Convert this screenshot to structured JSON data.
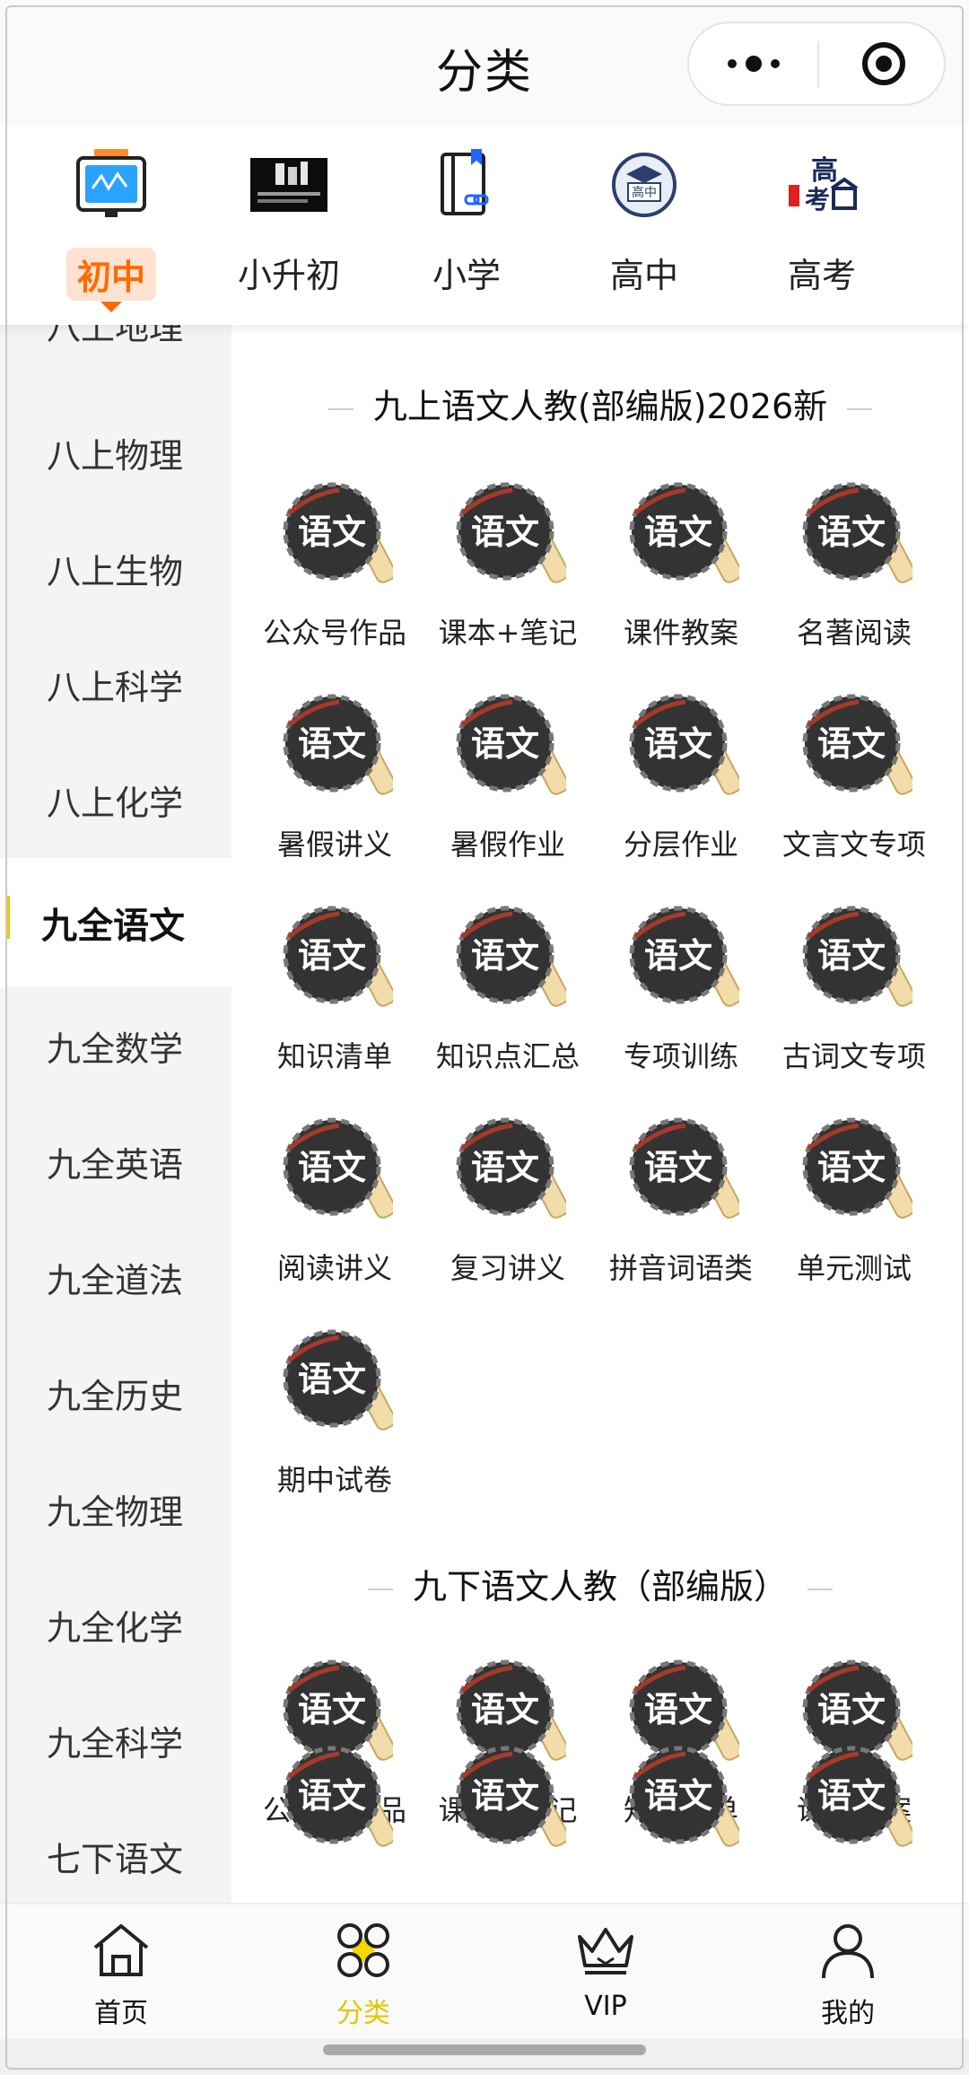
{
  "header": {
    "title": "分类"
  },
  "categories": [
    {
      "label": "初中",
      "icon": "whiteboard-icon",
      "active": true
    },
    {
      "label": "小升初",
      "icon": "poster-icon",
      "active": false
    },
    {
      "label": "小学",
      "icon": "book-link-icon",
      "active": false
    },
    {
      "label": "高中",
      "icon": "graduation-badge-icon",
      "active": false
    },
    {
      "label": "高考",
      "icon": "gaokao-building-icon",
      "active": false
    }
  ],
  "sidebar": {
    "items": [
      {
        "label": "八上地理"
      },
      {
        "label": "八上物理"
      },
      {
        "label": "八上生物"
      },
      {
        "label": "八上科学"
      },
      {
        "label": "八上化学"
      },
      {
        "label": "九全语文",
        "active": true
      },
      {
        "label": "九全数学"
      },
      {
        "label": "九全英语"
      },
      {
        "label": "九全道法"
      },
      {
        "label": "九全历史"
      },
      {
        "label": "九全物理"
      },
      {
        "label": "九全化学"
      },
      {
        "label": "九全科学"
      },
      {
        "label": "七下语文"
      }
    ]
  },
  "sections": [
    {
      "title": "九上语文人教(部编版)2026新",
      "tiles": [
        {
          "label": "公众号作品"
        },
        {
          "label": "课本+笔记"
        },
        {
          "label": "课件教案"
        },
        {
          "label": "名著阅读"
        },
        {
          "label": "暑假讲义"
        },
        {
          "label": "暑假作业"
        },
        {
          "label": "分层作业"
        },
        {
          "label": "文言文专项"
        },
        {
          "label": "知识清单"
        },
        {
          "label": "知识点汇总"
        },
        {
          "label": "专项训练"
        },
        {
          "label": "古词文专项"
        },
        {
          "label": "阅读讲义"
        },
        {
          "label": "复习讲义"
        },
        {
          "label": "拼音词语类"
        },
        {
          "label": "单元测试"
        },
        {
          "label": "期中试卷"
        }
      ]
    },
    {
      "title": "九下语文人教（部编版）",
      "tiles": [
        {
          "label": "公众号作品"
        },
        {
          "label": "课本+笔记"
        },
        {
          "label": "知识清单"
        },
        {
          "label": "课件教案"
        }
      ]
    }
  ],
  "tile_icon_text": "语文",
  "bottom_nav": [
    {
      "label": "首页",
      "icon": "home-icon"
    },
    {
      "label": "分类",
      "icon": "category-icon",
      "active": true
    },
    {
      "label": "VIP",
      "icon": "crown-icon"
    },
    {
      "label": "我的",
      "icon": "user-icon"
    }
  ],
  "colors": {
    "accent": "#ff6a00",
    "nav_active": "#e7c400",
    "sidebar_active_bar": "#f4c400"
  }
}
